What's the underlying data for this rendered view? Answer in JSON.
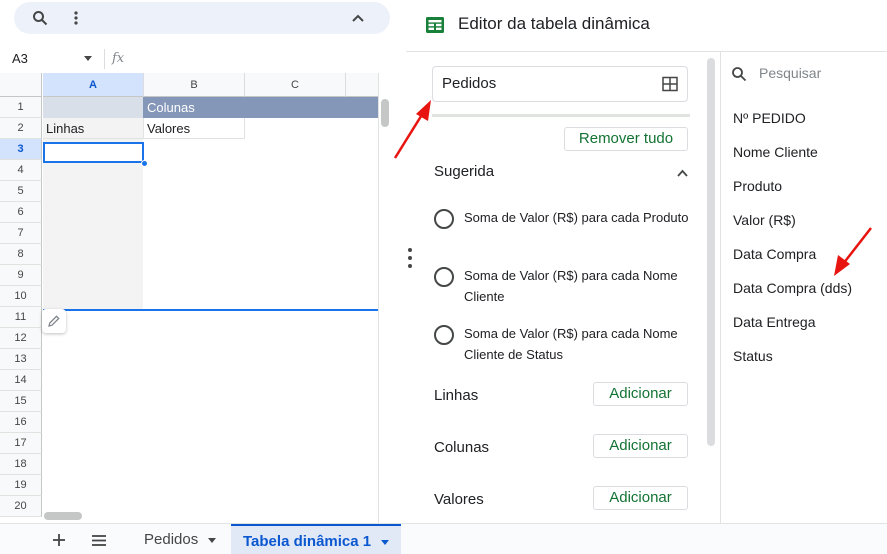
{
  "toolbar": {
    "search_icon": "search-icon",
    "more_icon": "more-vert-icon",
    "collapse_icon": "chevron-up-icon"
  },
  "formula_bar": {
    "cell_ref": "A3",
    "fx_label": "fx",
    "formula": ""
  },
  "grid": {
    "columns": [
      "A",
      "B",
      "C"
    ],
    "rows": [
      "1",
      "2",
      "3",
      "4",
      "5",
      "6",
      "7",
      "8",
      "9",
      "10",
      "11",
      "12",
      "13",
      "14",
      "15",
      "16",
      "17",
      "18",
      "19",
      "20"
    ],
    "selected_column": "A",
    "selected_row": "3",
    "cells": {
      "B1": "Colunas",
      "A2": "Linhas",
      "B2": "Valores"
    }
  },
  "sheet_tabs": {
    "add_icon": "add-icon",
    "list_icon": "menu-icon",
    "tabs": [
      {
        "label": "Pedidos",
        "active": false
      },
      {
        "label": "Tabela dinâmica 1",
        "active": true
      }
    ]
  },
  "editor": {
    "title": "Editor da tabela dinâmica",
    "range": "Pedidos",
    "remove_all": "Remover tudo",
    "suggested_label": "Sugerida",
    "suggestions": [
      "Soma de Valor (R$) para cada Produto",
      "Soma de Valor (R$) para cada Nome Cliente",
      "Soma de Valor (R$) para cada Nome Cliente de Status"
    ],
    "sections": [
      {
        "label": "Linhas",
        "button": "Adicionar"
      },
      {
        "label": "Colunas",
        "button": "Adicionar"
      },
      {
        "label": "Valores",
        "button": "Adicionar"
      }
    ],
    "search_placeholder": "Pesquisar",
    "fields": [
      "Nº PEDIDO",
      "Nome Cliente",
      "Produto",
      "Valor (R$)",
      "Data Compra",
      "Data Compra (dds)",
      "Data Entrega",
      "Status"
    ]
  },
  "colors": {
    "accent": "#0b57d0",
    "pivot_header": "#8597b9",
    "button_text": "#137333",
    "annotation": "#e8140f"
  }
}
